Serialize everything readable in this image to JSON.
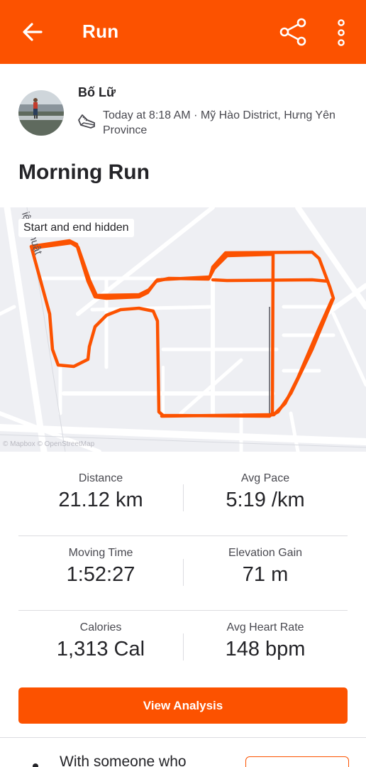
{
  "app_bar": {
    "title": "Run",
    "background": "#fc5200",
    "icons": [
      "back-arrow-icon",
      "share-icon",
      "more-vertical-icon"
    ]
  },
  "athlete": {
    "name": "Bố Lữ",
    "meta": "Today at 8:18 AM · Mỹ Hào District, Hưng Yên Province",
    "activity_icon": "running-shoe-icon"
  },
  "activity": {
    "title": "Morning Run"
  },
  "map": {
    "overlay_label": "Start and end hidden",
    "street_label": "iện Thuật",
    "attribution": "© Mapbox © OpenStreetMap",
    "route_color": "#fc5200"
  },
  "stats": [
    {
      "label": "Distance",
      "value": "21.12 km"
    },
    {
      "label": "Avg Pace",
      "value": "5:19 /km"
    },
    {
      "label": "Moving Time",
      "value": "1:52:27"
    },
    {
      "label": "Elevation Gain",
      "value": "71 m"
    },
    {
      "label": "Calories",
      "value": "1,313 Cal"
    },
    {
      "label": "Avg Heart Rate",
      "value": "148 bpm"
    }
  ],
  "actions": {
    "view_analysis": "View Analysis"
  },
  "suggestion": {
    "text": "With someone who"
  }
}
